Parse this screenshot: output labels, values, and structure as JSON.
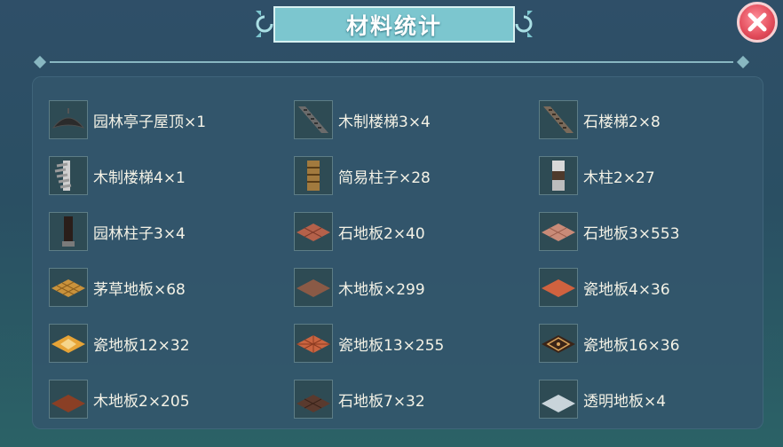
{
  "window": {
    "title": "材料统计"
  },
  "items": [
    {
      "label": "园林亭子屋顶×1",
      "icon": "garden-pavilion-roof-icon"
    },
    {
      "label": "木制楼梯3×4",
      "icon": "wooden-stairs-icon"
    },
    {
      "label": "石楼梯2×8",
      "icon": "stone-stairs-icon"
    },
    {
      "label": "木制楼梯4×1",
      "icon": "spiral-stairs-icon"
    },
    {
      "label": "简易柱子×28",
      "icon": "simple-pillar-icon"
    },
    {
      "label": "木柱2×27",
      "icon": "wooden-pillar-icon"
    },
    {
      "label": "园林柱子3×4",
      "icon": "garden-pillar-icon"
    },
    {
      "label": "石地板2×40",
      "icon": "stone-floor-tile-icon"
    },
    {
      "label": "石地板3×553",
      "icon": "stone-floor-tile-icon"
    },
    {
      "label": "茅草地板×68",
      "icon": "thatch-floor-tile-icon"
    },
    {
      "label": "木地板×299",
      "icon": "wood-floor-tile-icon"
    },
    {
      "label": "瓷地板4×36",
      "icon": "ceramic-floor-tile-icon"
    },
    {
      "label": "瓷地板12×32",
      "icon": "ceramic-floor-tile-icon"
    },
    {
      "label": "瓷地板13×255",
      "icon": "ceramic-floor-tile-icon"
    },
    {
      "label": "瓷地板16×36",
      "icon": "ceramic-floor-tile-icon"
    },
    {
      "label": "木地板2×205",
      "icon": "wood-floor-tile-icon"
    },
    {
      "label": "石地板7×32",
      "icon": "stone-floor-tile-icon"
    },
    {
      "label": "透明地板×4",
      "icon": "transparent-floor-tile-icon"
    }
  ]
}
